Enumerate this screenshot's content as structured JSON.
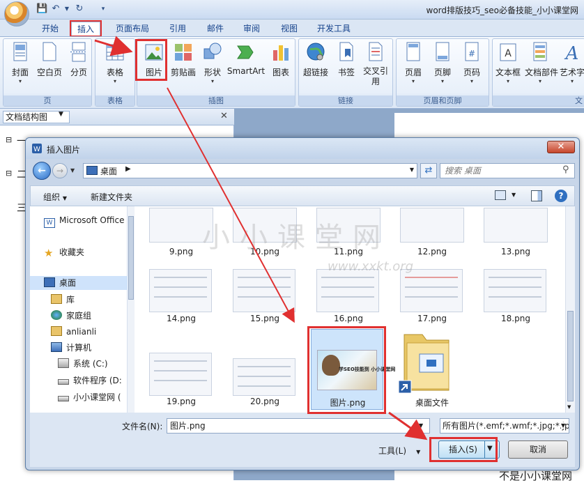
{
  "word": {
    "title": "word排版技巧_seo必备技能_小小课堂网",
    "tabs": [
      "开始",
      "插入",
      "页面布局",
      "引用",
      "邮件",
      "审阅",
      "视图",
      "开发工具"
    ],
    "groups": [
      {
        "label": "页",
        "buttons": [
          "封面",
          "空白页",
          "分页"
        ]
      },
      {
        "label": "表格",
        "buttons": [
          "表格"
        ]
      },
      {
        "label": "插图",
        "buttons": [
          "图片",
          "剪贴画",
          "形状",
          "SmartArt",
          "图表"
        ]
      },
      {
        "label": "链接",
        "buttons": [
          "超链接",
          "书签",
          "交叉引用"
        ]
      },
      {
        "label": "页眉和页脚",
        "buttons": [
          "页眉",
          "页脚",
          "页码"
        ]
      },
      {
        "label": "文",
        "buttons": [
          "文本框",
          "文档部件",
          "艺术字"
        ]
      }
    ],
    "nav_pane": {
      "select": "文档结构图",
      "items": [
        "一",
        "二",
        "三"
      ]
    }
  },
  "dialog": {
    "title": "插入图片",
    "address": "桌面",
    "search_placeholder": "搜索 桌面",
    "commands": {
      "organize": "组织",
      "new_folder": "新建文件夹"
    },
    "nav": {
      "office": "Microsoft Office",
      "favorites": "收藏夹",
      "desktop": "桌面",
      "library": "库",
      "homegroup": "家庭组",
      "user": "anlianli",
      "computer": "计算机",
      "drive_c": "系统 (C:)",
      "drive_d": "软件程序 (D:",
      "drive_e": "小小课堂网 ("
    },
    "files": [
      "9.png",
      "10.png",
      "11.png",
      "12.png",
      "13.png",
      "14.png",
      "15.png",
      "16.png",
      "17.png",
      "18.png",
      "19.png",
      "20.png",
      "图片.png",
      "桌面文件"
    ],
    "filename_label": "文件名(N):",
    "filename": "图片.png",
    "filetype": "所有图片(*.emf;*.wmf;*.jpg;*.jp",
    "tools": "工具(L)",
    "insert": "插入(S)",
    "cancel": "取消",
    "photo_caption": "学SEO技能到 小小课堂网"
  },
  "watermark": {
    "cn": "小小课堂网",
    "url": "www.xxkt.org"
  },
  "bottom_text": "不是小小课堂网",
  "colors": {
    "highlight": "#e03030",
    "ribbon_text": "#15428b"
  }
}
